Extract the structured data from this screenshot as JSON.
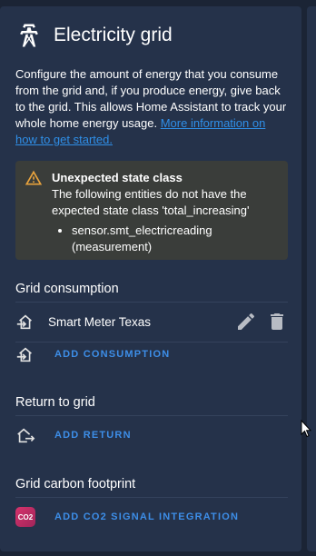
{
  "header": {
    "title": "Electricity grid",
    "icon": "transmission-tower-icon"
  },
  "description": {
    "text": "Configure the amount of energy that you consume from the grid and, if you produce energy, give back to the grid. This allows Home Assistant to track your whole home energy usage. ",
    "link": "More information on how to get started."
  },
  "warning": {
    "title": "Unexpected state class",
    "body": "The following entities do not have the expected state class 'total_increasing'",
    "items": [
      "sensor.smt_electricreading (measurement)"
    ],
    "color": "#e8a33d"
  },
  "consumption": {
    "title": "Grid consumption",
    "sources": [
      {
        "name": "Smart Meter Texas"
      }
    ],
    "add_label": "ADD CONSUMPTION"
  },
  "return": {
    "title": "Return to grid",
    "add_label": "ADD RETURN"
  },
  "carbon": {
    "title": "Grid carbon footprint",
    "badge": "CO2",
    "add_label": "ADD CO2 SIGNAL INTEGRATION"
  },
  "colors": {
    "accent": "#3d8ee8",
    "card": "#25324a",
    "background": "#1b2435"
  }
}
